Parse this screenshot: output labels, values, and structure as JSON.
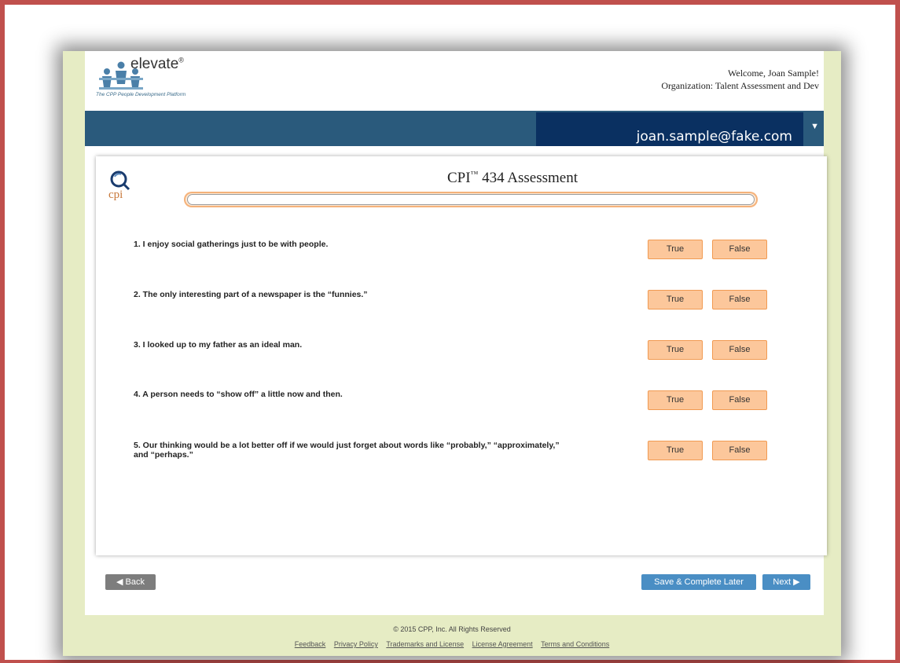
{
  "header": {
    "brand": "elevate",
    "brand_mark": "®",
    "tagline": "The CPP People Development Platform",
    "welcome": "Welcome, Joan Sample!",
    "organization": "Organization: Talent Assessment and Dev",
    "user_email": "joan.sample@fake.com",
    "user_menu_icon": "caret-down-icon"
  },
  "assessment": {
    "logo_text": "cpi",
    "title_prefix": "CPI",
    "title_mark": "™",
    "title_suffix": " 434 Assessment",
    "progress_fraction": 0.0,
    "true_label": "True",
    "false_label": "False",
    "questions": [
      "1. I enjoy social gatherings just to be with people.",
      "2. The only interesting part of a newspaper is the “funnies.”",
      "3. I looked up to my father as an ideal man.",
      "4. A person needs to “show off” a little now and then.",
      "5. Our thinking would be a lot better off if we would just forget about words like “probably,” “approximately,” and “perhaps.”"
    ]
  },
  "nav": {
    "back_label": "◀ Back",
    "save_label": "Save & Complete Later",
    "next_label": "Next ▶"
  },
  "footer": {
    "copyright": "© 2015 CPP, Inc. All Rights Reserved",
    "links": [
      "Feedback",
      "Privacy Policy",
      "Trademarks and License",
      "License Agreement",
      "Terms and Conditions"
    ]
  },
  "colors": {
    "frame": "#c0504d",
    "page_bg": "#e6ecc4",
    "navbar": "#2a5a7c",
    "user_box": "#0a3061",
    "answer_button": "#fcc79b",
    "primary_button": "#4a8ec4"
  }
}
